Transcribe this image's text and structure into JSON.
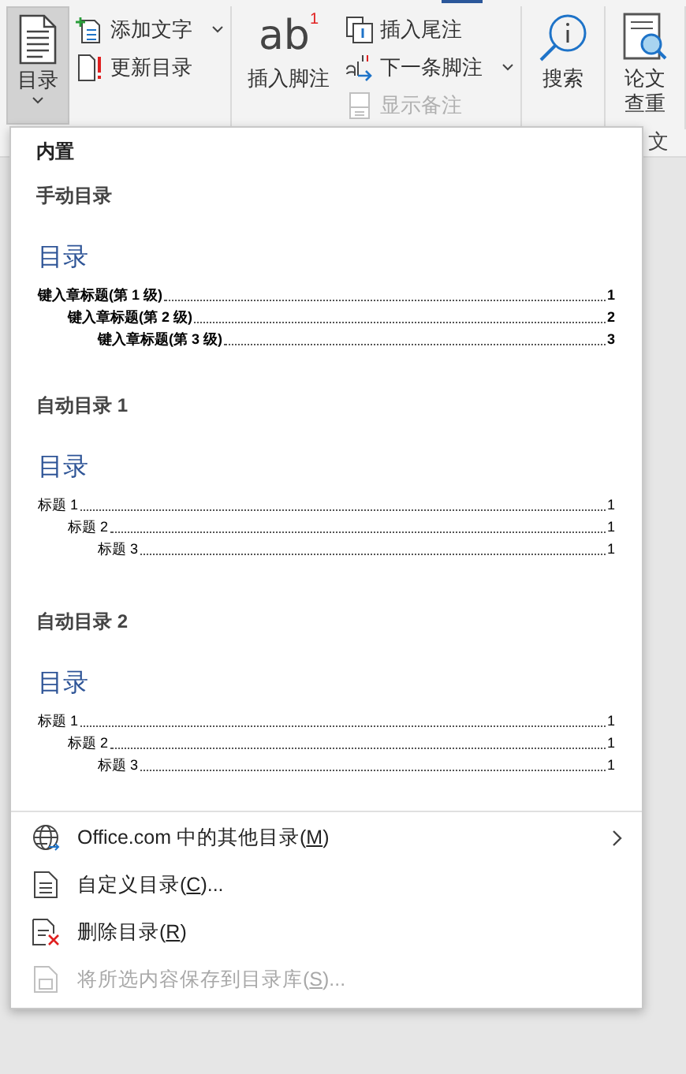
{
  "ribbon": {
    "groups": [
      {
        "buttons": [
          {
            "kind": "large",
            "label": "目录",
            "selected": true,
            "dropdown": true
          },
          {
            "kind": "small",
            "label": "添加文字",
            "dropdown": true,
            "disabled": false
          },
          {
            "kind": "small",
            "label": "更新目录",
            "dropdown": false,
            "disabled": false
          }
        ]
      },
      {
        "buttons": [
          {
            "kind": "large",
            "icon_text": "ab",
            "icon_mark": "1",
            "label": "插入脚注",
            "selected": false,
            "dropdown": false
          },
          {
            "kind": "small",
            "label": "插入尾注",
            "dropdown": false,
            "disabled": false
          },
          {
            "kind": "small",
            "label": "下一条脚注",
            "dropdown": true,
            "disabled": false
          },
          {
            "kind": "small",
            "label": "显示备注",
            "dropdown": false,
            "disabled": true
          }
        ]
      },
      {
        "buttons": [
          {
            "kind": "large",
            "label": "搜索",
            "selected": false,
            "dropdown": false
          }
        ]
      },
      {
        "buttons": [
          {
            "kind": "large",
            "label": "论文查重",
            "selected": false,
            "dropdown": false
          }
        ],
        "group_label": "文"
      }
    ]
  },
  "menu": {
    "section_header": "内置",
    "gallery": [
      {
        "title": "手动目录",
        "kind": "manual",
        "heading": "目录",
        "entries": [
          {
            "text": "键入章标题(第 1 级)",
            "page": "1",
            "children": [
              {
                "text": "键入章标题(第 2 级)",
                "page": "2",
                "children": [
                  {
                    "text": "键入章标题(第 3 级)",
                    "page": "3"
                  }
                ]
              }
            ]
          }
        ]
      },
      {
        "title": "自动目录 1",
        "kind": "auto",
        "heading": "目录",
        "entries": [
          {
            "text": "标题 1",
            "page": "1",
            "children": [
              {
                "text": "标题 2",
                "page": "1",
                "children": [
                  {
                    "text": "标题 3",
                    "page": "1"
                  }
                ]
              }
            ]
          }
        ]
      },
      {
        "title": "自动目录 2",
        "kind": "auto",
        "heading": "目录",
        "entries": [
          {
            "text": "标题 1",
            "page": "1",
            "children": [
              {
                "text": "标题 2",
                "page": "1",
                "children": [
                  {
                    "text": "标题 3",
                    "page": "1"
                  }
                ]
              }
            ]
          }
        ]
      }
    ],
    "items": [
      {
        "before": "Office.com 中的其他目录(",
        "access_key": "M",
        "after": ")",
        "submenu": true,
        "disabled": false
      },
      {
        "before": "自定义目录(",
        "access_key": "C",
        "after": ")...",
        "submenu": false,
        "disabled": false
      },
      {
        "before": "删除目录(",
        "access_key": "R",
        "after": ")",
        "submenu": false,
        "disabled": false
      },
      {
        "before": "将所选内容保存到目录库(",
        "access_key": "S",
        "after": ")...",
        "submenu": false,
        "disabled": true
      }
    ]
  }
}
